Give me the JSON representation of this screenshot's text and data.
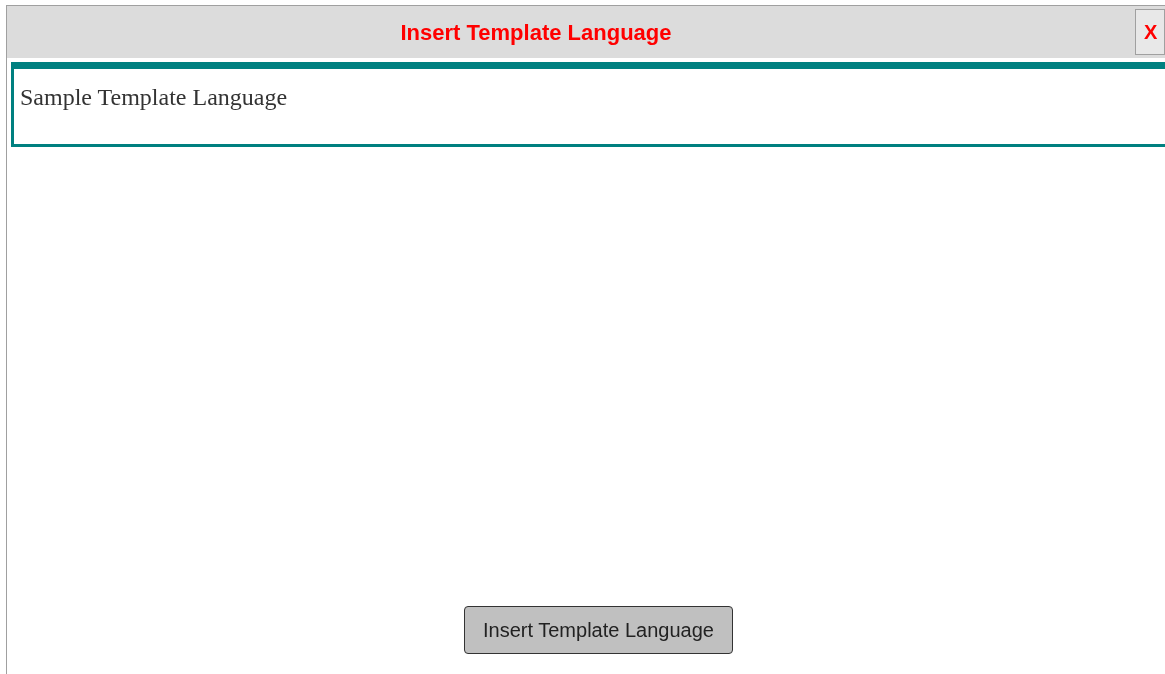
{
  "dialog": {
    "title": "Insert Template Language",
    "close_label": "X"
  },
  "editor": {
    "value": "Sample Template Language"
  },
  "buttons": [
    "Insert Template Language"
  ]
}
